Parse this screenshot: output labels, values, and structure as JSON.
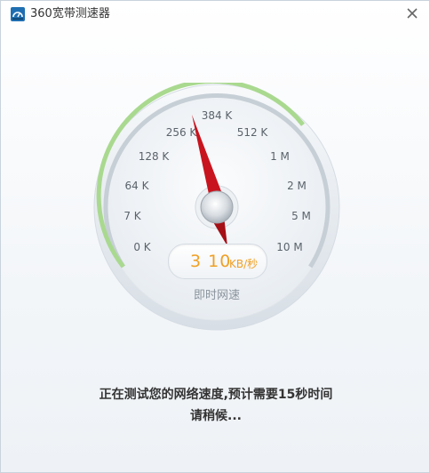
{
  "window": {
    "title": "360宽带测速器"
  },
  "gauge": {
    "scale_labels": [
      "0 K",
      "7 K",
      "64 K",
      "128 K",
      "256 K",
      "384 K",
      "512 K",
      "1 M",
      "2 M",
      "5 M",
      "10 M"
    ],
    "needle_label_index": 5,
    "speed_value": "3 10",
    "speed_unit": "KB/秒",
    "caption": "即时网速",
    "colors": {
      "arc_active": "#a9d98f",
      "arc_inactive": "#c7cfd6",
      "needle": "#c8141e",
      "speed_text": "#f0a025"
    }
  },
  "status": {
    "line1": "正在测试您的网络速度,预计需要15秒时间",
    "line2": "请稍候..."
  },
  "icons": {
    "app": "speedometer-icon",
    "close": "close-icon"
  }
}
